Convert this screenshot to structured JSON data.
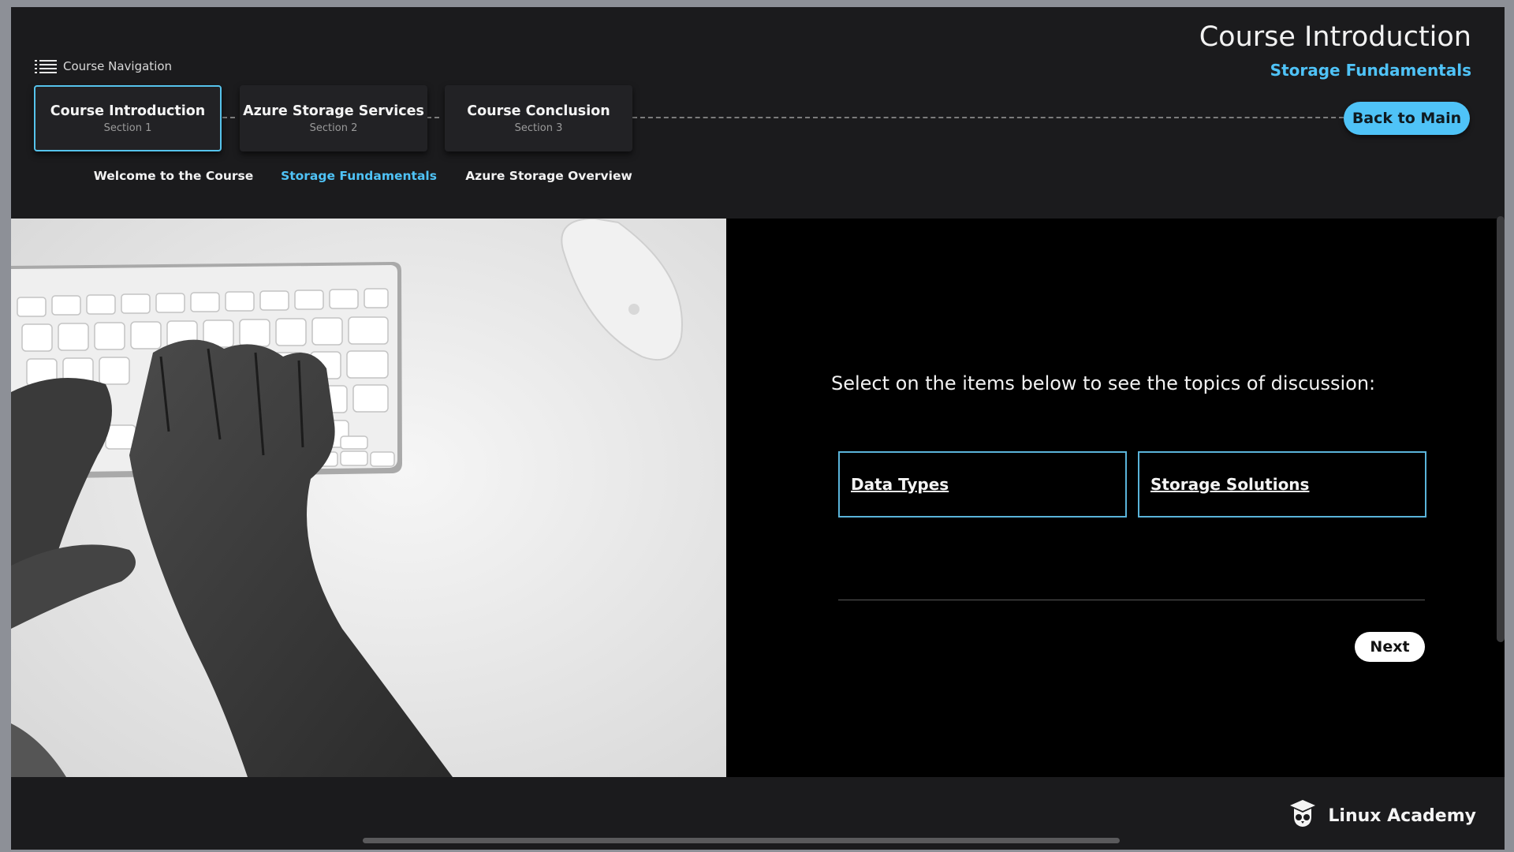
{
  "header": {
    "nav_label": "Course Navigation",
    "title": "Course Introduction",
    "subtitle": "Storage Fundamentals",
    "back_label": "Back to Main"
  },
  "sections": [
    {
      "title": "Course Introduction",
      "number": "Section 1",
      "caption": "Welcome to the Course",
      "active": true
    },
    {
      "title": "Azure Storage Services",
      "number": "Section 2",
      "caption": "Storage Fundamentals",
      "current": true
    },
    {
      "title": "Course Conclusion",
      "number": "Section 3",
      "caption": "Azure Storage Overview"
    }
  ],
  "main": {
    "image": "hands-typing-on-keyboard-photo",
    "prompt": "Select on the items below to see the topics of discussion:",
    "topics": [
      "Data Types",
      "Storage Solutions"
    ],
    "next_label": "Next"
  },
  "footer": {
    "brand": "Linux Academy",
    "logo_icon": "owl-graduation-cap-icon"
  },
  "colors": {
    "accent": "#4fc3f7",
    "background": "#1b1b1d",
    "content_bg": "#000000"
  }
}
